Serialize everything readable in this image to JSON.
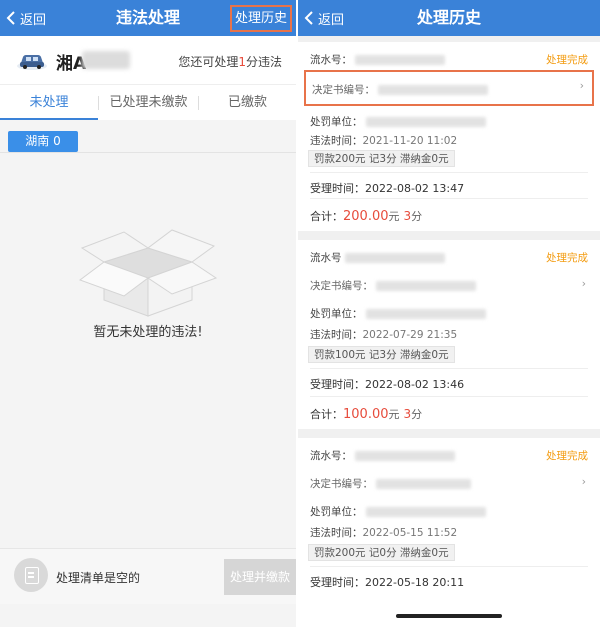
{
  "left": {
    "nav": {
      "back": "返回",
      "title": "违法处理",
      "history": "处理历史"
    },
    "plate": "湘A",
    "remain": {
      "prefix": "您还可处理",
      "count": "1",
      "suffix": "分违法"
    },
    "tabs": [
      "未处理",
      "已处理未缴款",
      "已缴款"
    ],
    "region": "湖南 0",
    "empty_message": "暂无未处理的违法!",
    "bottom": {
      "list_status": "处理清单是空的",
      "pay_button": "处理并缴款"
    },
    "colors": {
      "nav": "#3a82d8",
      "highlight": "#e8734a",
      "accent_red": "#e74c3c"
    }
  },
  "right": {
    "nav": {
      "back": "返回",
      "title": "处理历史"
    },
    "labels": {
      "serial": "流水号：",
      "serial_alt": "流水号",
      "decision": "决定书编号：",
      "unit": "处罚单位：",
      "violation_time": "违法时间：",
      "accepted": "受理时间：",
      "total": "合计："
    },
    "records": [
      {
        "status": "处理完成",
        "violation_time": "2021-11-20 11:02",
        "fine": "罚款200元",
        "points": "记3分",
        "late_fee": "滞纳金0元",
        "accepted_time": "2022-08-02 13:47",
        "total_amount": "200.00",
        "total_unit": "元",
        "total_points": "3",
        "total_points_unit": "分"
      },
      {
        "status": "处理完成",
        "violation_time": "2022-07-29 21:35",
        "fine": "罚款100元",
        "points": "记3分",
        "late_fee": "滞纳金0元",
        "accepted_time": "2022-08-02 13:46",
        "total_amount": "100.00",
        "total_unit": "元",
        "total_points": "3",
        "total_points_unit": "分"
      },
      {
        "status": "处理完成",
        "violation_time": "2022-05-15 11:52",
        "fine": "罚款200元",
        "points": "记0分",
        "late_fee": "滞纳金0元",
        "accepted_time": "2022-05-18 20:11"
      }
    ],
    "colors": {
      "status": "#f39c12"
    }
  }
}
